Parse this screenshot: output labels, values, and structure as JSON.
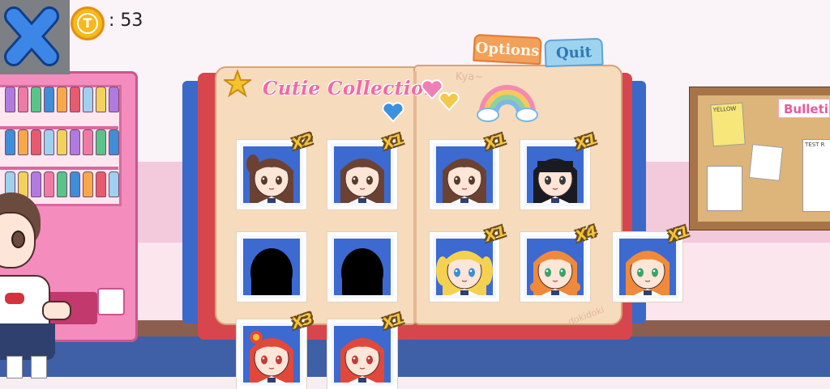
{
  "hud": {
    "coin_symbol": "T",
    "coin_count": ": 53",
    "close_icon": "close-x-icon"
  },
  "book": {
    "title": "Cutie Collection",
    "tabs": [
      {
        "label": "Options"
      },
      {
        "label": "Quit"
      }
    ],
    "scribbles": [
      "Kya~",
      "dokidoki"
    ]
  },
  "board": {
    "label": "Bulletin",
    "notes": [
      "YELLOW",
      "TEST R"
    ]
  },
  "characters": [
    {
      "id": "c1",
      "unlocked": true,
      "count": "X2",
      "hair": "#6b4232",
      "eyes": "#5a3a2a",
      "style": "ponytail"
    },
    {
      "id": "c2",
      "unlocked": true,
      "count": "X1",
      "hair": "#6b4232",
      "eyes": "#5a3a2a",
      "style": "long"
    },
    {
      "id": "c3",
      "unlocked": true,
      "count": "X1",
      "hair": "#6b4232",
      "eyes": "#5a3a2a",
      "style": "long"
    },
    {
      "id": "c4",
      "unlocked": true,
      "count": "X1",
      "hair": "#1a1a22",
      "eyes": "#3a3a3a",
      "style": "bangs"
    },
    {
      "id": "c5",
      "unlocked": false,
      "count": "",
      "hair": "#000000",
      "eyes": "",
      "style": "silhouette"
    },
    {
      "id": "c6",
      "unlocked": false,
      "count": "",
      "hair": "#000000",
      "eyes": "",
      "style": "silhouette"
    },
    {
      "id": "c7",
      "unlocked": true,
      "count": "X1",
      "hair": "#f4d24f",
      "eyes": "#3a8fd6",
      "style": "twintails"
    },
    {
      "id": "c8",
      "unlocked": true,
      "count": "X4",
      "hair": "#f08a3a",
      "eyes": "#3aa36a",
      "style": "braids"
    },
    {
      "id": "c9",
      "unlocked": true,
      "count": "X1",
      "hair": "#f08a3a",
      "eyes": "#3aa36a",
      "style": "long"
    },
    {
      "id": "c10",
      "unlocked": true,
      "count": "X3",
      "hair": "#e2483a",
      "eyes": "#c23a3a",
      "style": "bun"
    },
    {
      "id": "c11",
      "unlocked": true,
      "count": "X1",
      "hair": "#e2483a",
      "eyes": "#c23a3a",
      "style": "long"
    }
  ],
  "colors": {
    "title_pink": "#f06aa6",
    "badge_gold": "#f3c438",
    "card_blue": "#3c6ad1",
    "book_red": "#d7464d",
    "page": "#f6dbbc"
  }
}
